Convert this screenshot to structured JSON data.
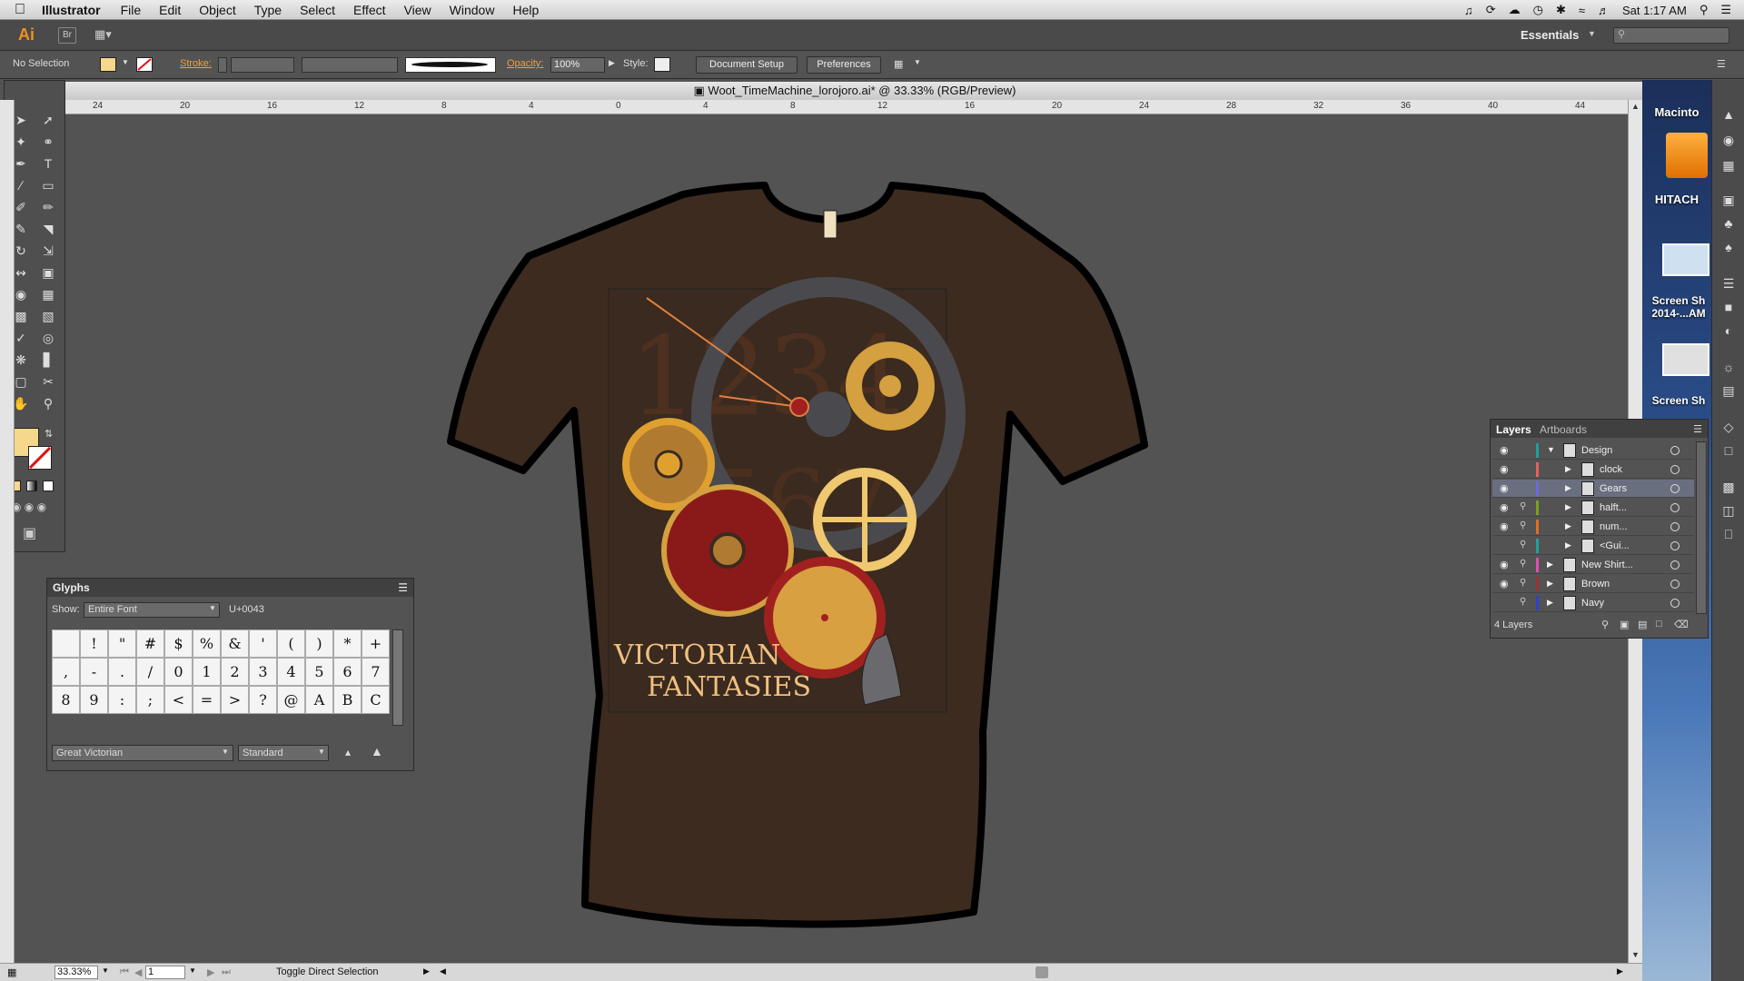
{
  "menubar": {
    "app_name": "Illustrator",
    "items": [
      "File",
      "Edit",
      "Object",
      "Type",
      "Select",
      "Effect",
      "View",
      "Window",
      "Help"
    ],
    "clock": "Sat 1:17 AM"
  },
  "appbar": {
    "logo": "Ai",
    "bridge_label": "Br",
    "workspace": "Essentials"
  },
  "controlbar": {
    "selection": "No Selection",
    "stroke_label": "Stroke:",
    "opacity_label": "Opacity:",
    "opacity_value": "100%",
    "style_label": "Style:",
    "document_setup": "Document Setup",
    "preferences": "Preferences"
  },
  "document": {
    "title": "Woot_TimeMachine_lorojoro.ai* @ 33.33% (RGB/Preview)",
    "ruler_ticks": [
      "24",
      "20",
      "16",
      "12",
      "8",
      "4",
      "0",
      "4",
      "8",
      "12",
      "16",
      "20",
      "24",
      "28",
      "32",
      "36",
      "40",
      "44"
    ],
    "shirt_color": "#3d2b1f",
    "design_title_line1": "VICTORIAN",
    "design_title_line2": "FANTASIES"
  },
  "status": {
    "zoom": "33.33%",
    "page": "1",
    "message": "Toggle Direct Selection"
  },
  "desktop": {
    "labels": [
      "Macinto",
      "HITACH",
      "Screen Sh 2014-...AM",
      "Screen Sh"
    ]
  },
  "glyphs_panel": {
    "title": "Glyphs",
    "show_label": "Show:",
    "show_value": "Entire Font",
    "unicode": "U+0043",
    "font": "Great Victorian",
    "style": "Standard",
    "row1": [
      "",
      "!",
      "\"",
      "#",
      "$",
      "%",
      "&",
      "'",
      "(",
      ")",
      "*",
      "+"
    ],
    "row2": [
      ",",
      "-",
      ".",
      "/",
      "0",
      "1",
      "2",
      "3",
      "4",
      "5",
      "6",
      "7"
    ],
    "row3": [
      "8",
      "9",
      ":",
      ";",
      "<",
      "=",
      ">",
      "?",
      "@",
      "A",
      "B",
      "C"
    ]
  },
  "layers_panel": {
    "tab_layers": "Layers",
    "tab_artboards": "Artboards",
    "count": "4 Layers",
    "rows": [
      {
        "name": "Design",
        "color": "#1aa0a0",
        "locked": false,
        "visible": true,
        "sub": false,
        "open": true
      },
      {
        "name": "clock",
        "color": "#e86060",
        "locked": false,
        "visible": true,
        "sub": true
      },
      {
        "name": "Gears",
        "color": "#6a6ae0",
        "locked": false,
        "visible": true,
        "sub": true,
        "selected": true
      },
      {
        "name": "halft...",
        "color": "#7aa020",
        "locked": true,
        "visible": true,
        "sub": true
      },
      {
        "name": "num...",
        "color": "#e07020",
        "locked": true,
        "visible": true,
        "sub": true
      },
      {
        "name": "<Gui...",
        "color": "#20a0a0",
        "locked": true,
        "visible": false,
        "sub": true
      },
      {
        "name": "New Shirt...",
        "color": "#e050b0",
        "locked": true,
        "visible": true,
        "sub": false
      },
      {
        "name": "Brown",
        "color": "#a03030",
        "locked": true,
        "visible": true,
        "sub": false
      },
      {
        "name": "Navy",
        "color": "#3040d0",
        "locked": true,
        "visible": false,
        "sub": false
      }
    ]
  }
}
